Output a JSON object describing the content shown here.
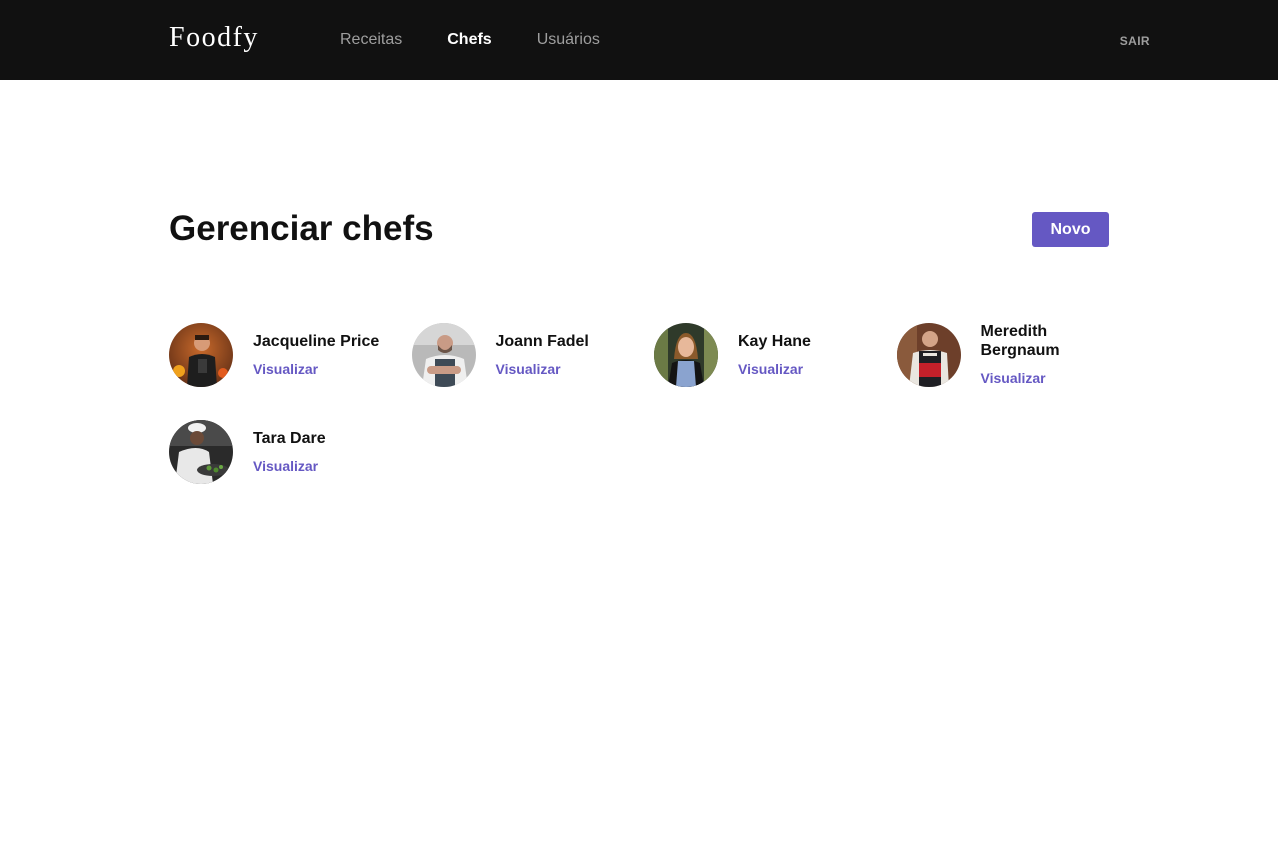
{
  "header": {
    "logo": "Foodfy",
    "nav": [
      {
        "label": "Receitas",
        "active": false
      },
      {
        "label": "Chefs",
        "active": true
      },
      {
        "label": "Usuários",
        "active": false
      }
    ],
    "logout_label": "SAIR"
  },
  "main": {
    "title": "Gerenciar chefs",
    "new_button_label": "Novo",
    "accent_color": "#6558c3",
    "chefs": [
      {
        "name": "Jacqueline Price",
        "link_label": "Visualizar",
        "avatar": "chef-photo-avatar"
      },
      {
        "name": "Joann Fadel",
        "link_label": "Visualizar",
        "avatar": "chef-photo-avatar"
      },
      {
        "name": "Kay Hane",
        "link_label": "Visualizar",
        "avatar": "chef-photo-avatar"
      },
      {
        "name": "Meredith Bergnaum",
        "link_label": "Visualizar",
        "avatar": "chef-photo-avatar"
      },
      {
        "name": "Tara Dare",
        "link_label": "Visualizar",
        "avatar": "chef-photo-avatar"
      }
    ]
  }
}
